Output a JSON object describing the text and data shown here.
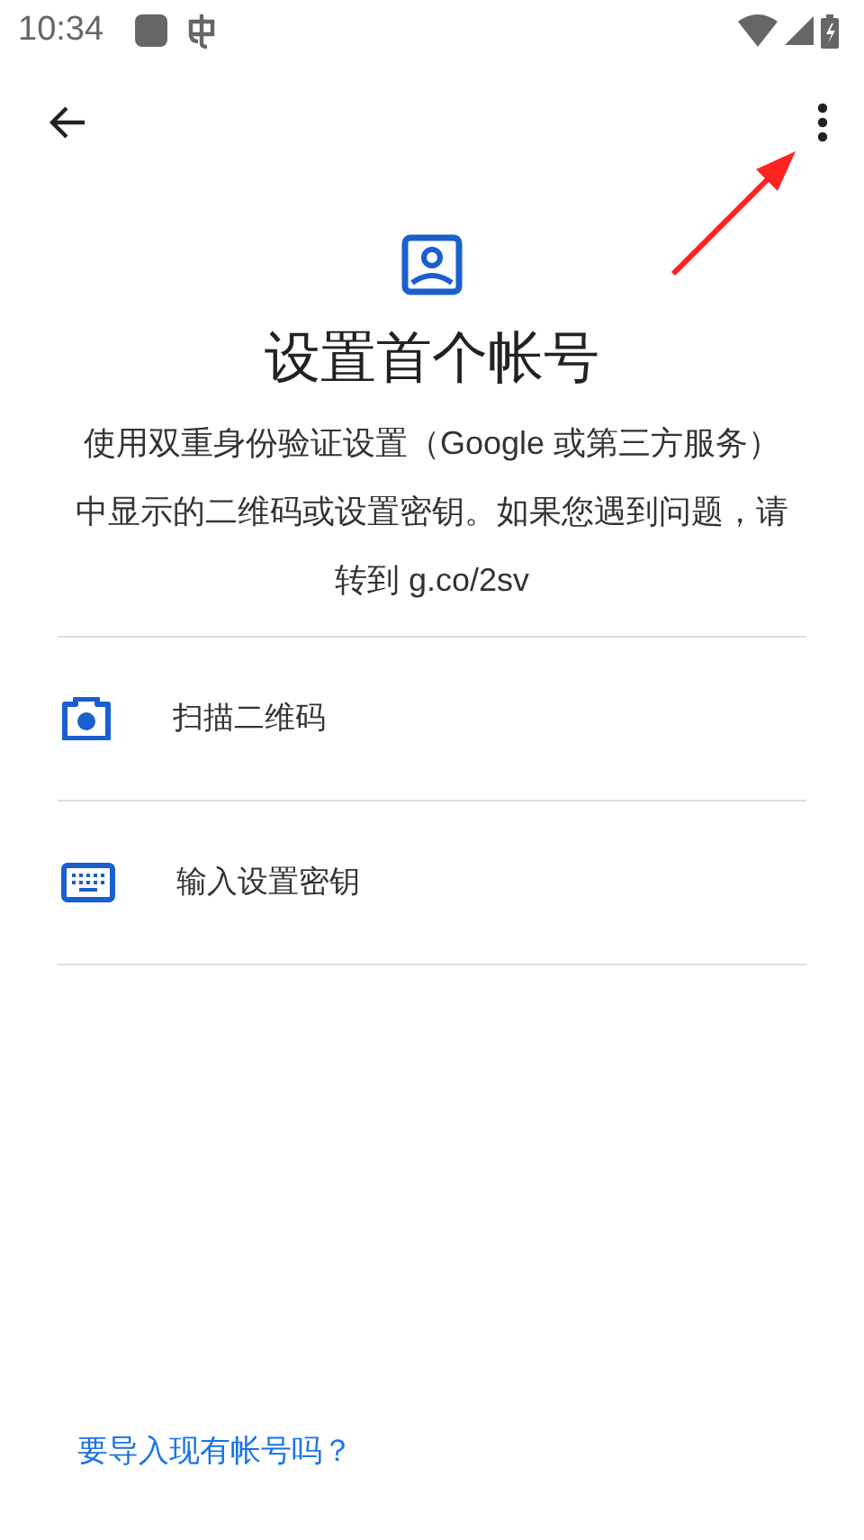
{
  "status_bar": {
    "time": "10:34"
  },
  "title": "设置首个帐号",
  "description_lines": [
    "使用双重身份验证设置（Google 或第三方服务）",
    "中显示的二维码或设置密钥。如果您遇到问题，请",
    "转到 g.co/2sv"
  ],
  "options": [
    {
      "kind": "camera",
      "label": "扫描二维码"
    },
    {
      "kind": "keyboard",
      "label": "输入设置密钥"
    }
  ],
  "import_link": "要导入现有帐号吗？",
  "annotation": {
    "kind": "arrow"
  }
}
